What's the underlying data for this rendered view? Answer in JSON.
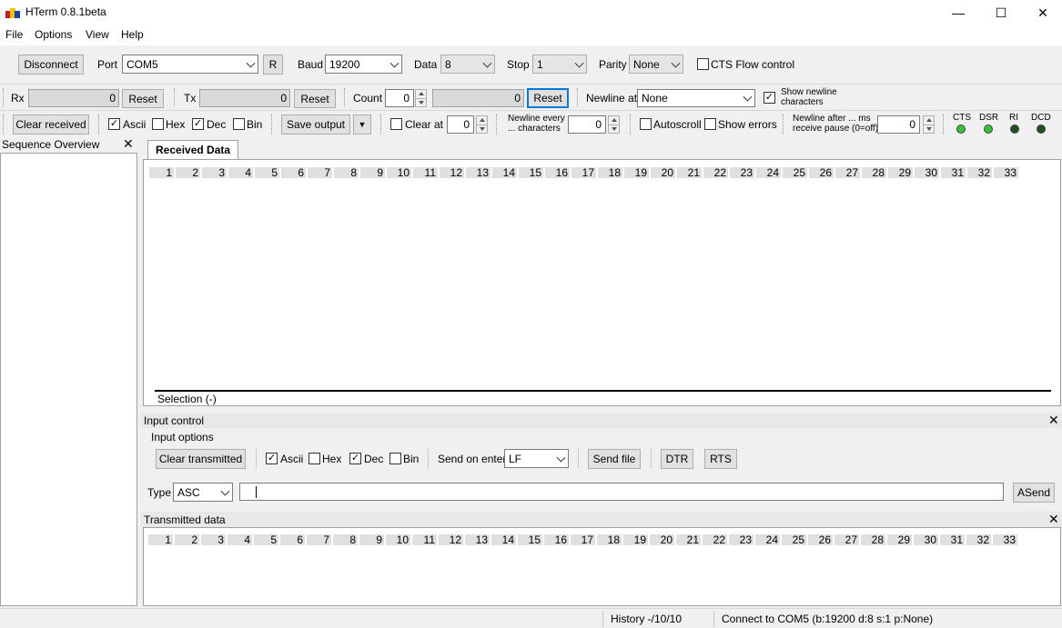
{
  "window": {
    "title": "HTerm 0.8.1beta",
    "minimize": "—",
    "maximize": "☐",
    "close": "✕"
  },
  "menu": [
    "File",
    "Options",
    "View",
    "Help"
  ],
  "connection": {
    "disconnect_label": "Disconnect",
    "port_label": "Port",
    "port_value": "COM5",
    "r_label": "R",
    "baud_label": "Baud",
    "baud_value": "19200",
    "data_label": "Data",
    "data_value": "8",
    "stop_label": "Stop",
    "stop_value": "1",
    "parity_label": "Parity",
    "parity_value": "None",
    "cts_flow_label": "CTS Flow control"
  },
  "counters": {
    "rx_label": "Rx",
    "rx_value": "0",
    "rx_reset": "Reset",
    "tx_label": "Tx",
    "tx_value": "0",
    "tx_reset": "Reset",
    "count_label": "Count",
    "count_value": "0",
    "count_field": "0",
    "count_reset": "Reset",
    "newline_at_label": "Newline at",
    "newline_at_value": "None",
    "show_newline_line1": "Show newline",
    "show_newline_line2": "characters"
  },
  "display": {
    "clear_received": "Clear received",
    "ascii": "Ascii",
    "hex": "Hex",
    "dec": "Dec",
    "bin": "Bin",
    "save_output": "Save output",
    "clear_at": "Clear at",
    "clear_at_value": "0",
    "newline_every_line1": "Newline every",
    "newline_every_line2": "... characters",
    "newline_every_value": "0",
    "autoscroll": "Autoscroll",
    "show_errors": "Show errors",
    "newline_after_line1": "Newline after ... ms",
    "newline_after_line2": "receive pause (0=off)",
    "newline_after_value": "0",
    "signals": [
      "CTS",
      "DSR",
      "RI",
      "DCD"
    ],
    "signal_colors": [
      "#36c236",
      "#36c236",
      "#1f4f1f",
      "#1f4f1f"
    ]
  },
  "sequence_overview": {
    "title": "Sequence Overview",
    "close": "✕"
  },
  "received": {
    "tab": "Received Data",
    "ruler": [
      "1",
      "2",
      "3",
      "4",
      "5",
      "6",
      "7",
      "8",
      "9",
      "10",
      "11",
      "12",
      "13",
      "14",
      "15",
      "16",
      "17",
      "18",
      "19",
      "20",
      "21",
      "22",
      "23",
      "24",
      "25",
      "26",
      "27",
      "28",
      "29",
      "30",
      "31",
      "32",
      "33"
    ],
    "selection": "Selection (-)"
  },
  "input_control": {
    "title": "Input control",
    "close": "✕",
    "options_label": "Input options",
    "clear_transmitted": "Clear transmitted",
    "ascii": "Ascii",
    "hex": "Hex",
    "dec": "Dec",
    "bin": "Bin",
    "send_on_enter_label": "Send on enter",
    "send_on_enter_value": "LF",
    "send_file": "Send file",
    "dtr": "DTR",
    "rts": "RTS",
    "type_label": "Type",
    "type_value": "ASC",
    "input_value": "",
    "asend": "ASend"
  },
  "transmitted": {
    "title": "Transmitted data",
    "close": "✕",
    "ruler": [
      "1",
      "2",
      "3",
      "4",
      "5",
      "6",
      "7",
      "8",
      "9",
      "10",
      "11",
      "12",
      "13",
      "14",
      "15",
      "16",
      "17",
      "18",
      "19",
      "20",
      "21",
      "22",
      "23",
      "24",
      "25",
      "26",
      "27",
      "28",
      "29",
      "30",
      "31",
      "32",
      "33"
    ]
  },
  "status": {
    "history": "History -/10/10",
    "connection": "Connect to COM5 (b:19200 d:8 s:1 p:None)"
  }
}
